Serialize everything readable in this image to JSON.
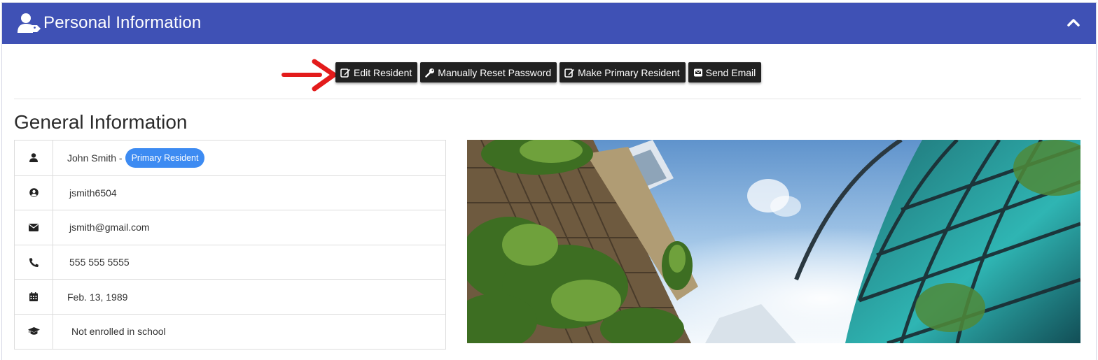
{
  "header": {
    "title": "Personal Information",
    "color": "#3f51b5"
  },
  "actions": [
    {
      "label": "Edit Resident",
      "icon": "edit-icon"
    },
    {
      "label": "Manually Reset Password",
      "icon": "key-icon"
    },
    {
      "label": "Make Primary Resident",
      "icon": "edit-icon"
    },
    {
      "label": "Send Email",
      "icon": "email-icon"
    }
  ],
  "section_title": "General Information",
  "info": {
    "name": "John Smith -",
    "badge": "Primary Resident",
    "username": "jsmith6504",
    "email": "jsmith@gmail.com",
    "phone": "555 555 5555",
    "birthdate": "Feb. 13, 1989",
    "school": "Not enrolled in school"
  },
  "colors": {
    "badge": "#3d8bf2",
    "button": "#212121",
    "arrow": "#e31b1b"
  }
}
